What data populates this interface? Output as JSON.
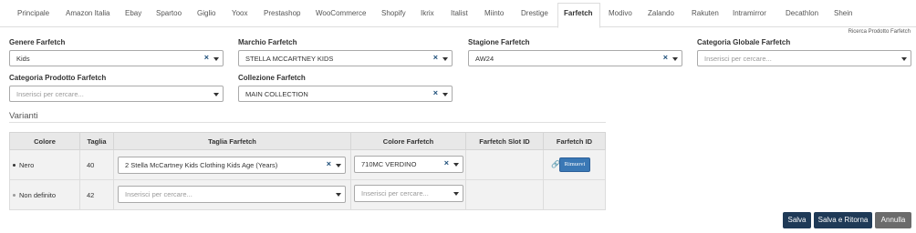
{
  "tabs": [
    "Principale",
    "Amazon Italia",
    "Ebay",
    "Spartoo",
    "Giglio",
    "Yoox",
    "Prestashop",
    "WooCommerce",
    "Shopify",
    "Ikrix",
    "Italist",
    "Miinto",
    "Drestige",
    "Farfetch",
    "Modivo",
    "Zalando",
    "Rakuten",
    "Intramirror",
    "Decathlon",
    "Shein"
  ],
  "active_tab": "Farfetch",
  "ricerca_link": "Ricerca Prodotto Farfetch",
  "form": {
    "genere": {
      "label": "Genere Farfetch",
      "value": "Kids"
    },
    "marchio": {
      "label": "Marchio Farfetch",
      "value": "STELLA MCCARTNEY KIDS"
    },
    "stagione": {
      "label": "Stagione Farfetch",
      "value": "AW24"
    },
    "categoria_globale": {
      "label": "Categoria Globale Farfetch",
      "placeholder": "Inserisci per cercare..."
    },
    "categoria_prodotto": {
      "label": "Categoria Prodotto Farfetch",
      "placeholder": "Inserisci per cercare..."
    },
    "collezione": {
      "label": "Collezione Farfetch",
      "value": "MAIN COLLECTION"
    }
  },
  "varianti": {
    "title": "Varianti",
    "headers": [
      "Colore",
      "Taglia",
      "Taglia Farfetch",
      "Colore Farfetch",
      "Farfetch Slot ID",
      "Farfetch ID"
    ],
    "rows": [
      {
        "colore": "Nero",
        "taglia": "40",
        "taglia_farfetch": "2 Stella McCartney Kids Clothing Kids Age (Years)",
        "colore_farfetch": "710MC VERDINO",
        "button": "Rimuovi"
      },
      {
        "colore": "Non definito",
        "taglia": "42",
        "taglia_farfetch_placeholder": "Inserisci per cercare...",
        "colore_farfetch_placeholder": "Inserisci per cercare..."
      }
    ]
  },
  "buttons": {
    "salva": "Salva",
    "salva_ritorna": "Salva e Ritorna",
    "annulla": "Annulla"
  },
  "glyphs": {
    "clear": "×",
    "link": "🔗",
    "bullet": "•"
  }
}
